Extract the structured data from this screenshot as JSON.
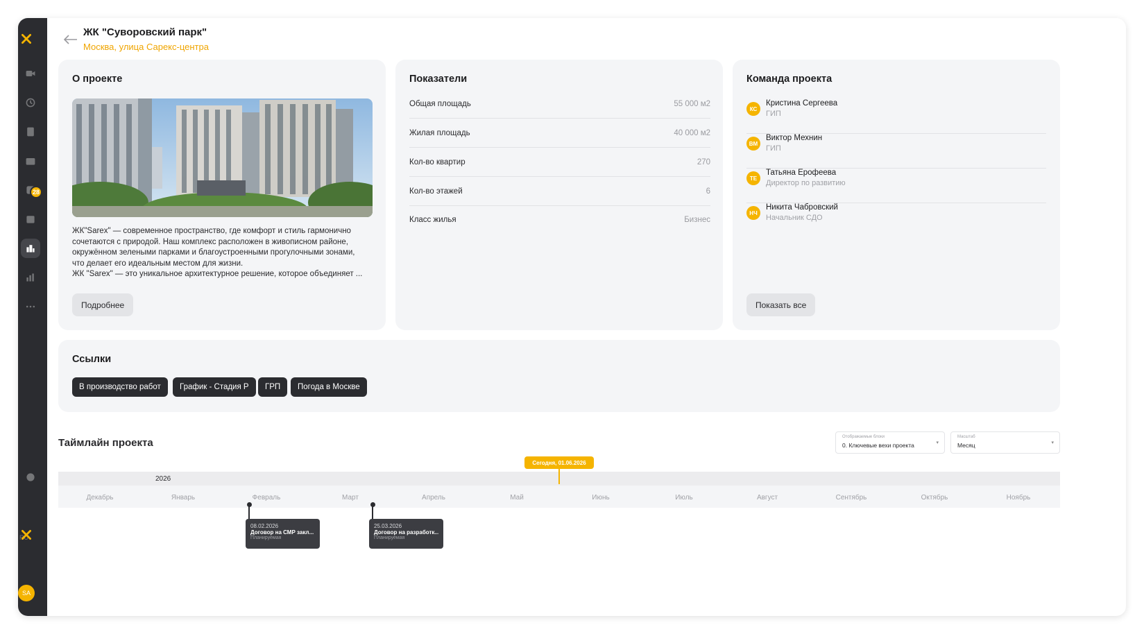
{
  "header": {
    "title": "ЖК \"Суворовский парк\"",
    "address": "Москва, улица Сарекс-центра"
  },
  "sidebar": {
    "badge_count": "28",
    "lang": "RU",
    "avatar": "SA",
    "accent": "#f5b400"
  },
  "about": {
    "title": "О проекте",
    "text_lines": [
      "ЖК\"Sarex\" — современное пространство, где комфорт и стиль гармонично",
      "сочетаются с природой. Наш комплекс расположен в живописном районе,",
      "окружённом зелеными парками и благоустроенными прогулочными зонами,",
      "что делает его идеальным местом для жизни.",
      "ЖК \"Sarex\" — это уникальное архитектурное решение, которое объединяет ..."
    ],
    "more_button": "Подробнее"
  },
  "metrics": {
    "title": "Показатели",
    "rows": [
      {
        "label": "Общая площадь",
        "value": "55 000 м2"
      },
      {
        "label": "Жилая площадь",
        "value": "40 000 м2"
      },
      {
        "label": "Кол-во квартир",
        "value": "270"
      },
      {
        "label": "Кол-во этажей",
        "value": "6"
      },
      {
        "label": "Класс жилья",
        "value": "Бизнес"
      }
    ]
  },
  "team": {
    "title": "Команда проекта",
    "members": [
      {
        "initials": "КС",
        "name": "Кристина Сергеева",
        "role": "ГИП"
      },
      {
        "initials": "ВМ",
        "name": "Виктор Мехнин",
        "role": "ГИП"
      },
      {
        "initials": "ТЕ",
        "name": "Татьяна Ерофеева",
        "role": "Директор по развитию"
      },
      {
        "initials": "НЧ",
        "name": "Никита Чабровский",
        "role": "Начальник СДО"
      }
    ],
    "show_all_button": "Показать все"
  },
  "links": {
    "title": "Ссылки",
    "items": [
      "В производство работ",
      "График - Стадия Р",
      "ГРП",
      "Погода в Москве"
    ]
  },
  "timeline": {
    "title": "Таймлайн проекта",
    "blocks_select": {
      "label": "Отображаемые блоки",
      "value": "0. Ключевые вехи проекта"
    },
    "scale_select": {
      "label": "Масштаб",
      "value": "Месяц"
    },
    "today_label": "Сегодня, 01.06.2026",
    "year": "2026",
    "months": [
      "Декабрь",
      "Январь",
      "Февраль",
      "Март",
      "Апрель",
      "Май",
      "Июнь",
      "Июль",
      "Август",
      "Сентябрь",
      "Октябрь",
      "Ноябрь"
    ],
    "events": [
      {
        "date": "08.02.2026",
        "title": "Договор на СМР закл...",
        "status": "Планируемая"
      },
      {
        "date": "25.03.2026",
        "title": "Договор на разработк...",
        "status": "Планируемая"
      }
    ]
  }
}
